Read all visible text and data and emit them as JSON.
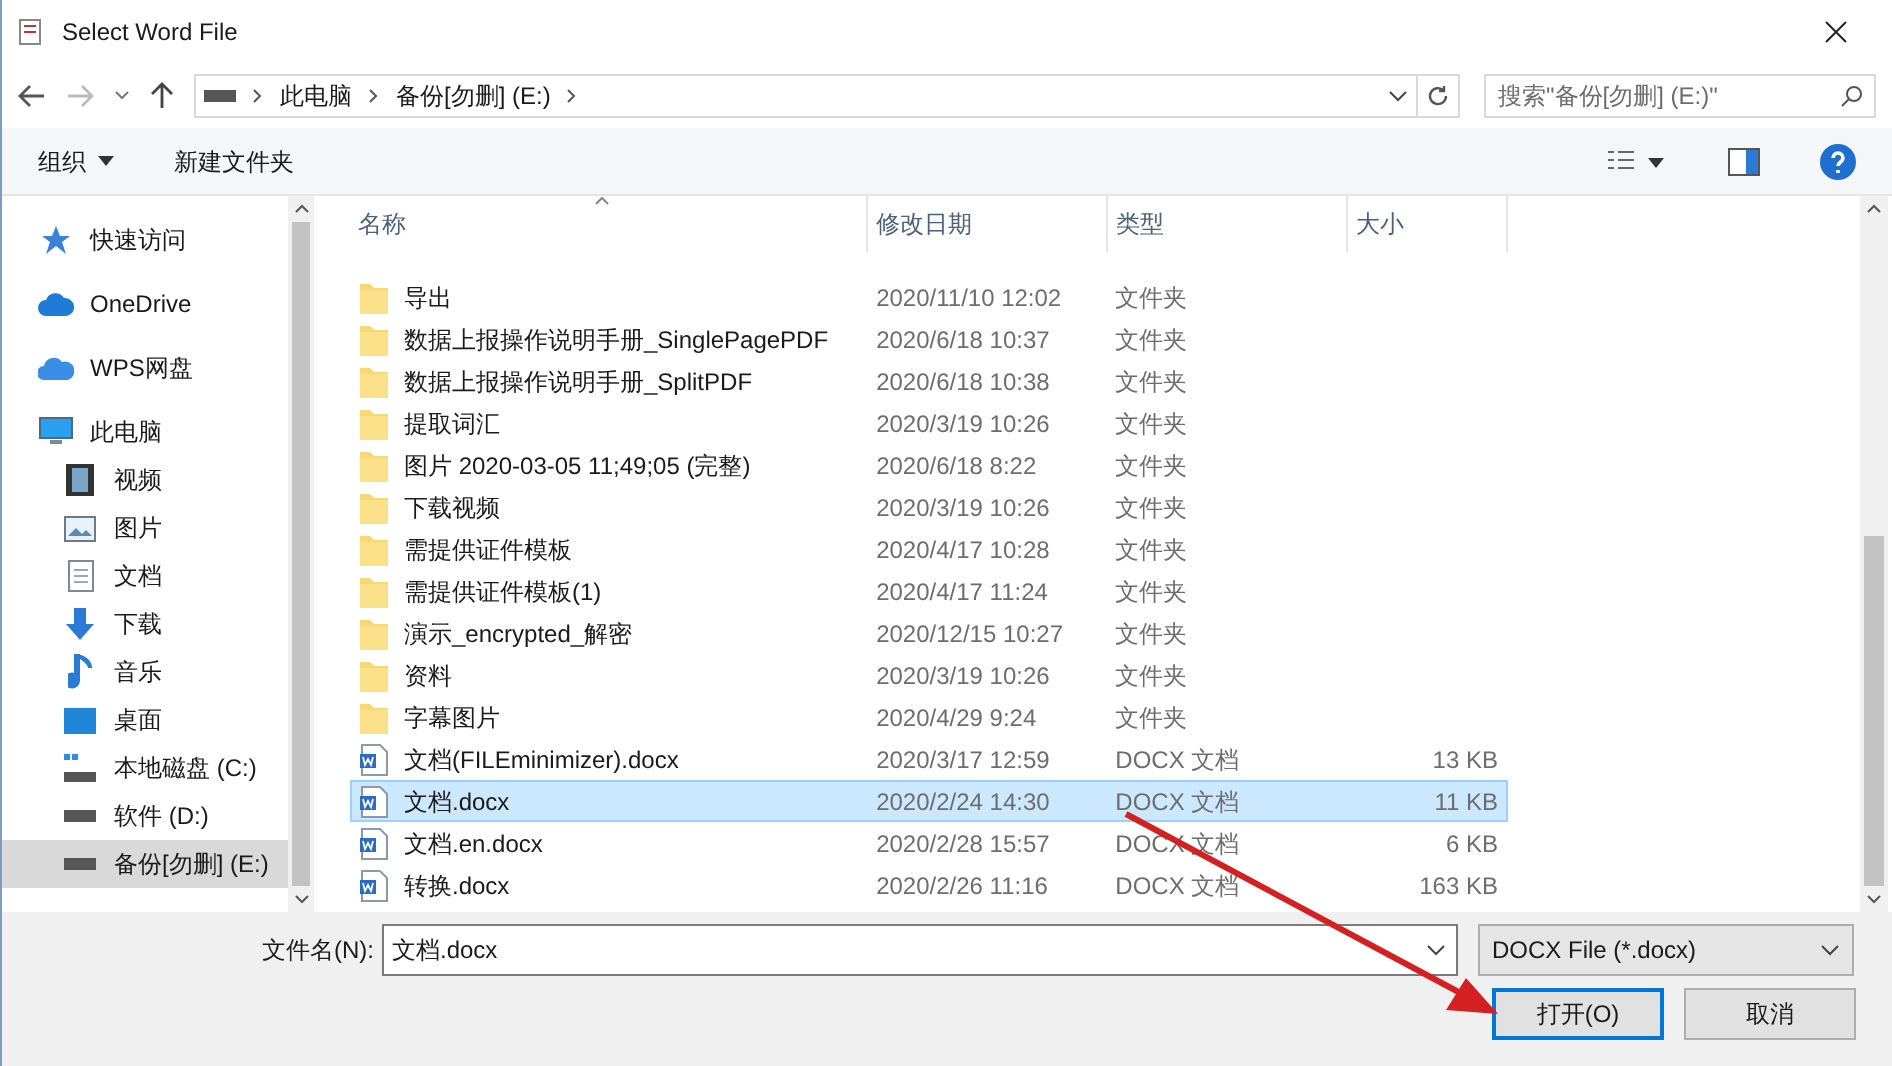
{
  "window": {
    "title": "Select Word File"
  },
  "address": {
    "crumbs": [
      "此电脑",
      "备份[勿删] (E:)"
    ]
  },
  "search": {
    "placeholder": "搜索\"备份[勿删] (E:)\""
  },
  "toolbar": {
    "organize": "组织",
    "new_folder": "新建文件夹"
  },
  "sidebar": {
    "items": [
      {
        "label": "快速访问",
        "kind": "star",
        "selected": false
      },
      {
        "label": "OneDrive",
        "kind": "cloud",
        "selected": false
      },
      {
        "label": "WPS网盘",
        "kind": "wps",
        "selected": false
      },
      {
        "label": "此电脑",
        "kind": "pc",
        "selected": false,
        "children": [
          {
            "label": "视频",
            "kind": "video",
            "selected": false
          },
          {
            "label": "图片",
            "kind": "picture",
            "selected": false
          },
          {
            "label": "文档",
            "kind": "doc",
            "selected": false
          },
          {
            "label": "下载",
            "kind": "download",
            "selected": false
          },
          {
            "label": "音乐",
            "kind": "music",
            "selected": false
          },
          {
            "label": "桌面",
            "kind": "desktop",
            "selected": false
          },
          {
            "label": "本地磁盘 (C:)",
            "kind": "sysdrive",
            "selected": false
          },
          {
            "label": "软件 (D:)",
            "kind": "drive",
            "selected": false
          },
          {
            "label": "备份[勿删] (E:)",
            "kind": "drive",
            "selected": true
          }
        ]
      }
    ]
  },
  "table": {
    "columns": [
      "名称",
      "修改日期",
      "类型",
      "大小"
    ],
    "rows": [
      {
        "name": "导出",
        "date": "2020/11/10 12:02",
        "type": "文件夹",
        "kind": "folder",
        "selected": false
      },
      {
        "name": "数据上报操作说明手册_SinglePagePDF",
        "date": "2020/6/18 10:37",
        "type": "文件夹",
        "kind": "folder",
        "selected": false
      },
      {
        "name": "数据上报操作说明手册_SplitPDF",
        "date": "2020/6/18 10:38",
        "type": "文件夹",
        "kind": "folder",
        "selected": false
      },
      {
        "name": "提取词汇",
        "date": "2020/3/19 10:26",
        "type": "文件夹",
        "kind": "folder",
        "selected": false
      },
      {
        "name": "图片 2020-03-05 11;49;05 (完整)",
        "date": "2020/6/18 8:22",
        "type": "文件夹",
        "kind": "folder",
        "selected": false
      },
      {
        "name": "下载视频",
        "date": "2020/3/19 10:26",
        "type": "文件夹",
        "kind": "folder",
        "selected": false
      },
      {
        "name": "需提供证件模板",
        "date": "2020/4/17 10:28",
        "type": "文件夹",
        "kind": "folder",
        "selected": false
      },
      {
        "name": "需提供证件模板(1)",
        "date": "2020/4/17 11:24",
        "type": "文件夹",
        "kind": "folder",
        "selected": false
      },
      {
        "name": "演示_encrypted_解密",
        "date": "2020/12/15 10:27",
        "type": "文件夹",
        "kind": "folder",
        "selected": false
      },
      {
        "name": "资料",
        "date": "2020/3/19 10:26",
        "type": "文件夹",
        "kind": "folder",
        "selected": false
      },
      {
        "name": "字幕图片",
        "date": "2020/4/29 9:24",
        "type": "文件夹",
        "kind": "folder",
        "selected": false
      },
      {
        "name": "文档(FILEminimizer).docx",
        "date": "2020/3/17 12:59",
        "type": "DOCX 文档",
        "size": "13 KB",
        "kind": "docx",
        "selected": false
      },
      {
        "name": "文档.docx",
        "date": "2020/2/24 14:30",
        "type": "DOCX 文档",
        "size": "11 KB",
        "kind": "docx",
        "selected": true
      },
      {
        "name": "文档.en.docx",
        "date": "2020/2/28 15:57",
        "type": "DOCX 文档",
        "size": "6 KB",
        "kind": "docx",
        "selected": false
      },
      {
        "name": "转换.docx",
        "date": "2020/2/26 11:16",
        "type": "DOCX 文档",
        "size": "163 KB",
        "kind": "docx",
        "selected": false
      }
    ]
  },
  "footer": {
    "filename_label": "文件名(N):",
    "filename": "文档.docx",
    "filter": "DOCX File (*.docx)",
    "buttons": [
      "打开(O)",
      "取消"
    ]
  }
}
